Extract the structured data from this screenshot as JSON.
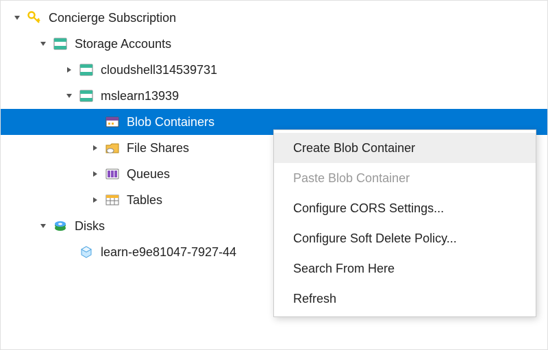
{
  "tree": {
    "subscription": "Concierge Subscription",
    "storage_accounts": "Storage Accounts",
    "accounts": {
      "cloudshell": "cloudshell314539731",
      "mslearn": "mslearn13939"
    },
    "services": {
      "blob": "Blob Containers",
      "files": "File Shares",
      "queues": "Queues",
      "tables": "Tables"
    },
    "disks": "Disks",
    "disk_item": "learn-e9e81047-7927-44"
  },
  "context_menu": {
    "create": "Create Blob Container",
    "paste": "Paste Blob Container",
    "cors": "Configure CORS Settings...",
    "softdelete": "Configure Soft Delete Policy...",
    "search": "Search From Here",
    "refresh": "Refresh"
  }
}
